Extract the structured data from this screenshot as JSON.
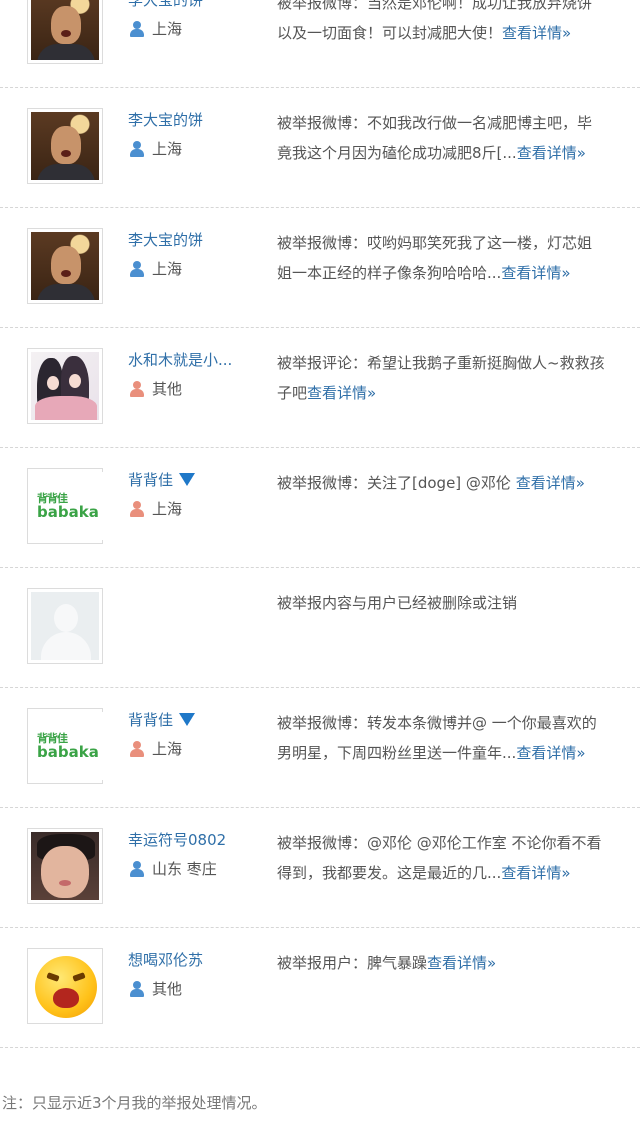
{
  "reports": [
    {
      "username": "李大宝的饼",
      "verified": false,
      "location": "上海",
      "gender": "male",
      "avatar": "photo-man",
      "text_lines": [
        "被举报微博：当然是邓伦啊！成功让我放弃烧饼",
        "以及一切面食！可以封减肥大使！"
      ],
      "link": "查看详情»"
    },
    {
      "username": "李大宝的饼",
      "verified": false,
      "location": "上海",
      "gender": "male",
      "avatar": "photo-man",
      "text_lines": [
        "被举报微博：不如我改行做一名减肥博主吧，毕",
        "竟我这个月因为磕伦成功减肥8斤[..."
      ],
      "link": "查看详情»"
    },
    {
      "username": "李大宝的饼",
      "verified": false,
      "location": "上海",
      "gender": "male",
      "avatar": "photo-man",
      "text_lines": [
        "被举报微博：哎哟妈耶笑死我了这一楼，灯芯姐",
        "姐一本正经的样子像条狗哈哈哈..."
      ],
      "link": "查看详情»"
    },
    {
      "username": "水和木就是小...",
      "verified": false,
      "location": "其他",
      "gender": "female",
      "avatar": "anime",
      "text_lines": [
        "被举报评论：希望让我鹅子重新挺胸做人~救救孩",
        "子吧"
      ],
      "link": "查看详情»"
    },
    {
      "username": "背背佳",
      "verified": true,
      "location": "上海",
      "gender": "female",
      "avatar": "babaka",
      "avatar_text_cn": "背背佳",
      "avatar_text_en": "babaka",
      "text_lines": [
        "被举报微博：关注了[doge] @邓伦 "
      ],
      "link": "查看详情»"
    },
    {
      "username": "",
      "verified": false,
      "location": "",
      "gender": "",
      "avatar": "blank",
      "text_lines": [
        "被举报内容与用户已经被删除或注销"
      ],
      "link": ""
    },
    {
      "username": "背背佳",
      "verified": true,
      "location": "上海",
      "gender": "female",
      "avatar": "babaka",
      "avatar_text_cn": "背背佳",
      "avatar_text_en": "babaka",
      "text_lines": [
        "被举报微博：转发本条微博并@ 一个你最喜欢的",
        "男明星，下周四粉丝里送一件童年..."
      ],
      "link": "查看详情»"
    },
    {
      "username": "幸运符号0802",
      "verified": false,
      "location": "山东 枣庄",
      "gender": "male",
      "avatar": "selfie",
      "text_lines": [
        "被举报微博：@邓伦 @邓伦工作室 不论你看不看",
        "得到，我都要发。这是最近的几..."
      ],
      "link": "查看详情»"
    },
    {
      "username": "想喝邓伦苏",
      "verified": false,
      "location": "其他",
      "gender": "male",
      "avatar": "emoji",
      "text_lines": [
        "被举报用户：脾气暴躁"
      ],
      "link": "查看详情»"
    }
  ],
  "footer_note": "注：只显示近3个月我的举报处理情况。",
  "colors": {
    "link": "#2f6fa8",
    "verified_badge": "#1f78c8",
    "divider": "#d6d6d6"
  }
}
